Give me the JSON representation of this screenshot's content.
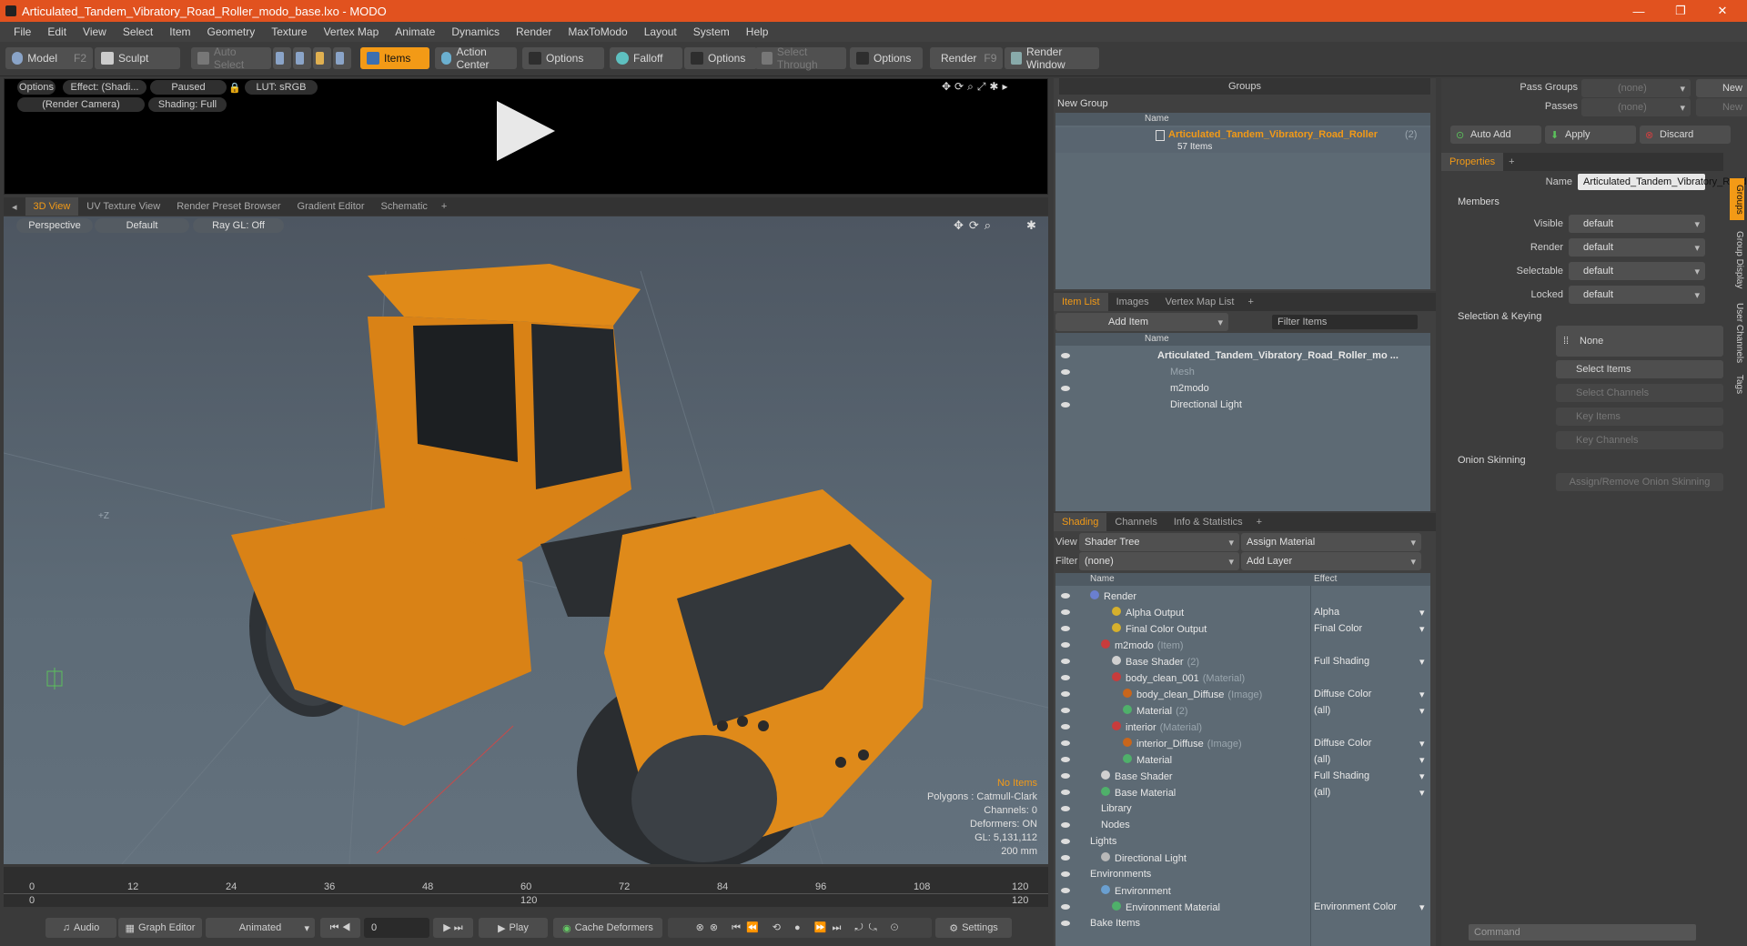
{
  "window": {
    "title": "Articulated_Tandem_Vibratory_Road_Roller_modo_base.lxo - MODO",
    "min": "—",
    "max": "❐",
    "close": "✕"
  },
  "menu": [
    "File",
    "Edit",
    "View",
    "Select",
    "Item",
    "Geometry",
    "Texture",
    "Vertex Map",
    "Animate",
    "Dynamics",
    "Render",
    "MaxToModo",
    "Layout",
    "System",
    "Help"
  ],
  "toolbar": {
    "model": "Model",
    "model_key": "F2",
    "sculpt": "Sculpt",
    "auto_select": "Auto Select",
    "items": "Items",
    "action_center": "Action Center",
    "options1": "Options",
    "falloff": "Falloff",
    "options2": "Options",
    "select_through": "Select Through",
    "options3": "Options",
    "render": "Render",
    "render_key": "F9",
    "render_window": "Render Window"
  },
  "preview": {
    "options": "Options",
    "effect": "Effect: (Shadi...",
    "paused": "Paused",
    "lut": "LUT: sRGB",
    "camera": "(Render Camera)",
    "shading": "Shading: Full"
  },
  "viewport_tabs": [
    "3D View",
    "UV Texture View",
    "Render Preset Browser",
    "Gradient Editor",
    "Schematic"
  ],
  "viewport": {
    "perspective": "Perspective",
    "default": "Default",
    "raygl": "Ray GL: Off",
    "axis_label": "+Z",
    "stats": {
      "no_items": "No Items",
      "polygons": "Polygons : Catmull-Clark",
      "channels": "Channels: 0",
      "deformers": "Deformers: ON",
      "gl": "GL: 5,131,112",
      "scale": "200 mm"
    }
  },
  "timeline": {
    "ticks": [
      "0",
      "12",
      "24",
      "36",
      "48",
      "60",
      "72",
      "84",
      "96",
      "108",
      "120"
    ],
    "sub_ticks": [
      "0",
      "120",
      "120"
    ]
  },
  "bottombar": {
    "audio": "Audio",
    "graph_editor": "Graph Editor",
    "animated": "Animated",
    "frame": "0",
    "play": "Play",
    "cache": "Cache Deformers",
    "settings": "Settings"
  },
  "groups": {
    "title": "Groups",
    "new_group": "New Group",
    "col_name": "Name",
    "item": "Articulated_Tandem_Vibratory_Road_Roller",
    "item_count": "(2)",
    "items": "57 Items"
  },
  "itemlist": {
    "tabs": [
      "Item List",
      "Images",
      "Vertex Map List"
    ],
    "add_item": "Add Item",
    "filter": "Filter Items",
    "col_name": "Name",
    "rows": [
      {
        "label": "Articulated_Tandem_Vibratory_Road_Roller_mo ...",
        "dim": false
      },
      {
        "label": "Mesh",
        "dim": true
      },
      {
        "label": "m2modo",
        "dim": false
      },
      {
        "label": "Directional Light",
        "dim": false
      }
    ]
  },
  "shading": {
    "tabs": [
      "Shading",
      "Channels",
      "Info & Statistics"
    ],
    "view_label": "View",
    "view_value": "Shader Tree",
    "assign": "Assign Material",
    "filter_label": "Filter",
    "filter_value": "(none)",
    "add_layer": "Add Layer",
    "col_name": "Name",
    "col_effect": "Effect",
    "rows": [
      {
        "name": "Render",
        "tag": "",
        "effect": "",
        "ind": 0,
        "color": "#6a7fd0"
      },
      {
        "name": "Alpha Output",
        "tag": "",
        "effect": "Alpha",
        "ind": 2,
        "color": "#d6b02c"
      },
      {
        "name": "Final Color Output",
        "tag": "",
        "effect": "Final Color",
        "ind": 2,
        "color": "#d6b02c"
      },
      {
        "name": "m2modo",
        "tag": "(Item)",
        "effect": "",
        "ind": 1,
        "color": "#c83c3c"
      },
      {
        "name": "Base Shader",
        "tag": "(2)",
        "effect": "Full Shading",
        "ind": 2,
        "color": "#d0d0d0"
      },
      {
        "name": "body_clean_001",
        "tag": "(Material)",
        "effect": "",
        "ind": 2,
        "color": "#c83c3c"
      },
      {
        "name": "body_clean_Diffuse",
        "tag": "(Image)",
        "effect": "Diffuse Color",
        "ind": 3,
        "color": "#c8661c"
      },
      {
        "name": "Material",
        "tag": "(2)",
        "effect": "(all)",
        "ind": 3,
        "color": "#4fb06a"
      },
      {
        "name": "interior",
        "tag": "(Material)",
        "effect": "",
        "ind": 2,
        "color": "#c83c3c"
      },
      {
        "name": "interior_Diffuse",
        "tag": "(Image)",
        "effect": "Diffuse Color",
        "ind": 3,
        "color": "#c8661c"
      },
      {
        "name": "Material",
        "tag": "",
        "effect": "(all)",
        "ind": 3,
        "color": "#4fb06a"
      },
      {
        "name": "Base Shader",
        "tag": "",
        "effect": "Full Shading",
        "ind": 1,
        "color": "#d0d0d0"
      },
      {
        "name": "Base Material",
        "tag": "",
        "effect": "(all)",
        "ind": 1,
        "color": "#4fb06a"
      },
      {
        "name": "Library",
        "tag": "",
        "effect": "",
        "ind": 1,
        "color": ""
      },
      {
        "name": "Nodes",
        "tag": "",
        "effect": "",
        "ind": 1,
        "color": ""
      },
      {
        "name": "Lights",
        "tag": "",
        "effect": "",
        "ind": 0,
        "color": ""
      },
      {
        "name": "Directional Light",
        "tag": "",
        "effect": "",
        "ind": 1,
        "color": "#b8b8b8"
      },
      {
        "name": "Environments",
        "tag": "",
        "effect": "",
        "ind": 0,
        "color": ""
      },
      {
        "name": "Environment",
        "tag": "",
        "effect": "",
        "ind": 1,
        "color": "#6a9fd0"
      },
      {
        "name": "Environment Material",
        "tag": "",
        "effect": "Environment Color",
        "ind": 2,
        "color": "#4fb06a"
      },
      {
        "name": "Bake Items",
        "tag": "",
        "effect": "",
        "ind": 0,
        "color": ""
      }
    ]
  },
  "right": {
    "pass_groups": "Pass Groups",
    "passes": "Passes",
    "none1": "(none)",
    "none2": "(none)",
    "new1": "New",
    "new2": "New",
    "auto_add": "Auto Add",
    "apply": "Apply",
    "discard": "Discard",
    "properties": "Properties",
    "name_label": "Name",
    "name_value": "Articulated_Tandem_Vibratory_Road",
    "members": "Members",
    "visible": "Visible",
    "render": "Render",
    "selectable": "Selectable",
    "locked": "Locked",
    "default": "default",
    "selection_keying": "Selection & Keying",
    "none": "None",
    "select_items": "Select Items",
    "select_channels": "Select Channels",
    "key_items": "Key Items",
    "key_channels": "Key Channels",
    "onion": "Onion Skinning",
    "assign_onion": "Assign/Remove Onion Skinning",
    "command": "Command",
    "side_tabs": [
      "Groups",
      "Group Display",
      "User Channels",
      "Tags"
    ]
  }
}
